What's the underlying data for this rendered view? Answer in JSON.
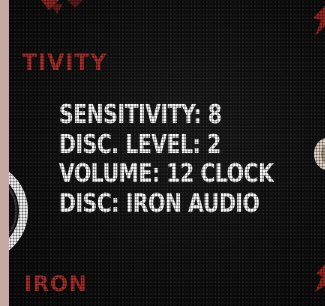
{
  "background": {
    "surface_color": "#141414",
    "accent_color": "#b5302b",
    "border_color": "#c4aaa2"
  },
  "brand": {
    "top_text": "TIVITY",
    "bottom_text": "IRON"
  },
  "readout": {
    "sensitivity": "SENSITIVITY: 8",
    "disc_level": "DISC. LEVEL: 2",
    "volume": "VOLUME: 12 CLOCK",
    "disc": "DISC: IRON AUDIO"
  }
}
